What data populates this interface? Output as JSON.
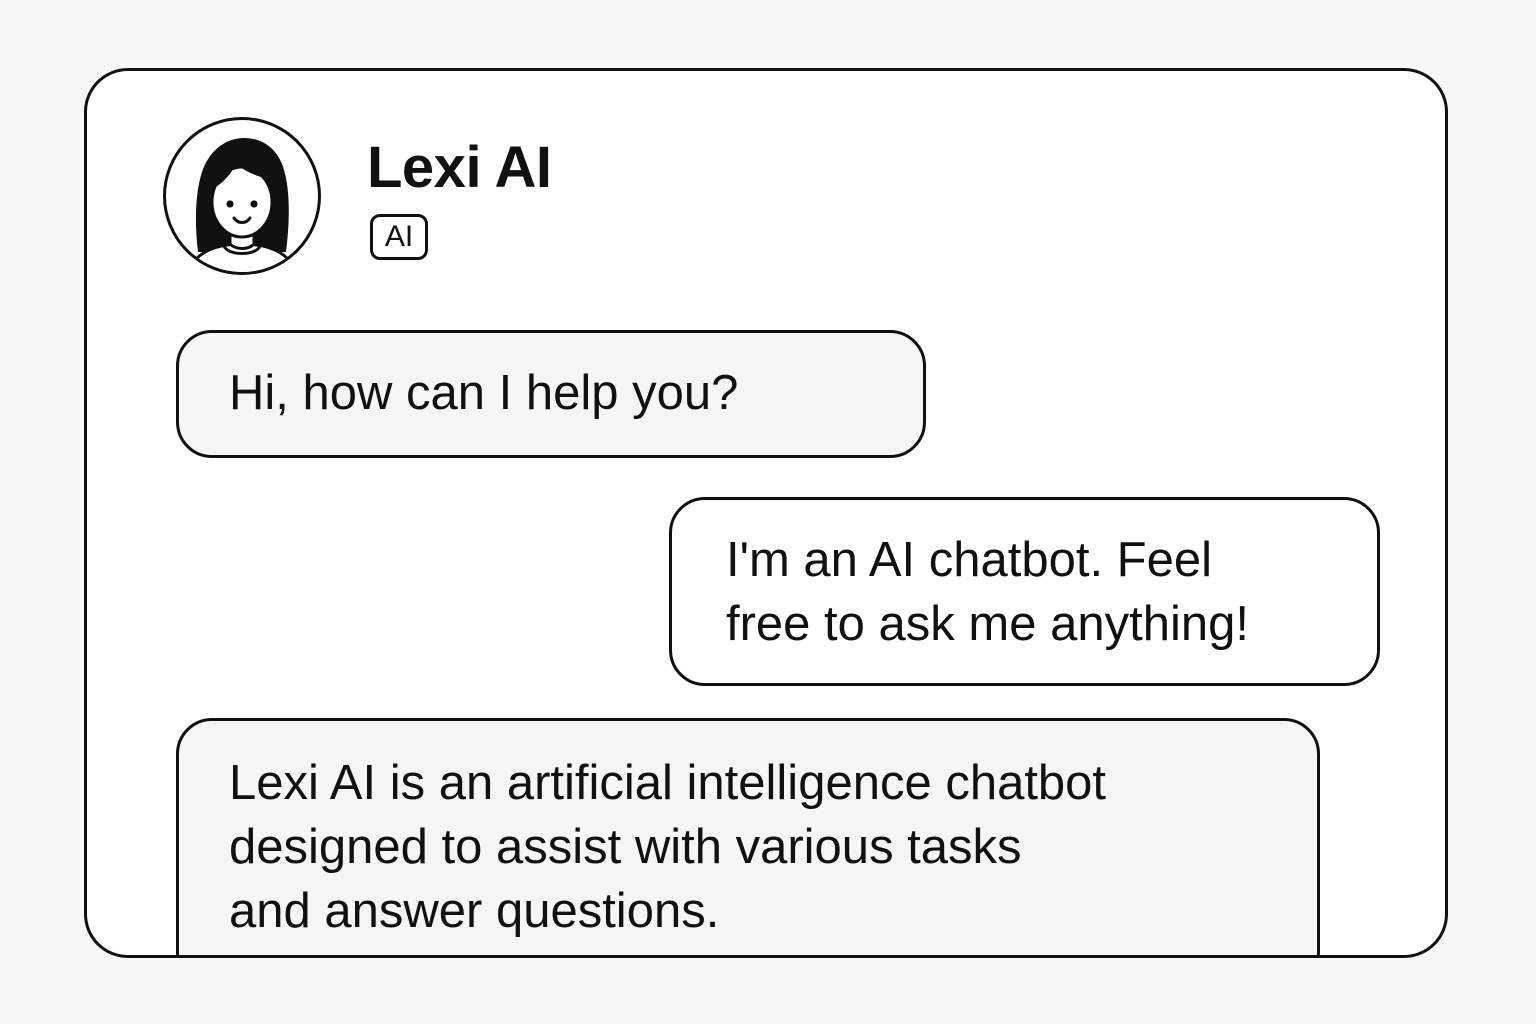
{
  "header": {
    "bot_name": "Lexi AI",
    "badge": "AI",
    "avatar_icon": "woman-avatar-icon"
  },
  "messages": [
    {
      "sender": "bot",
      "lines": [
        "Hi, how can I help you?"
      ]
    },
    {
      "sender": "user",
      "lines": [
        "I'm an AI chatbot. Feel",
        "free to ask me anything!"
      ]
    },
    {
      "sender": "bot",
      "lines": [
        "Lexi AI is an artificial intelligence chatbot",
        "designed to assist with various tasks",
        "and answer questions."
      ]
    }
  ],
  "colors": {
    "border": "#111111",
    "bot_bubble_bg": "#f5f5f5",
    "user_bubble_bg": "#ffffff",
    "page_bg": "#f7f7f7"
  }
}
